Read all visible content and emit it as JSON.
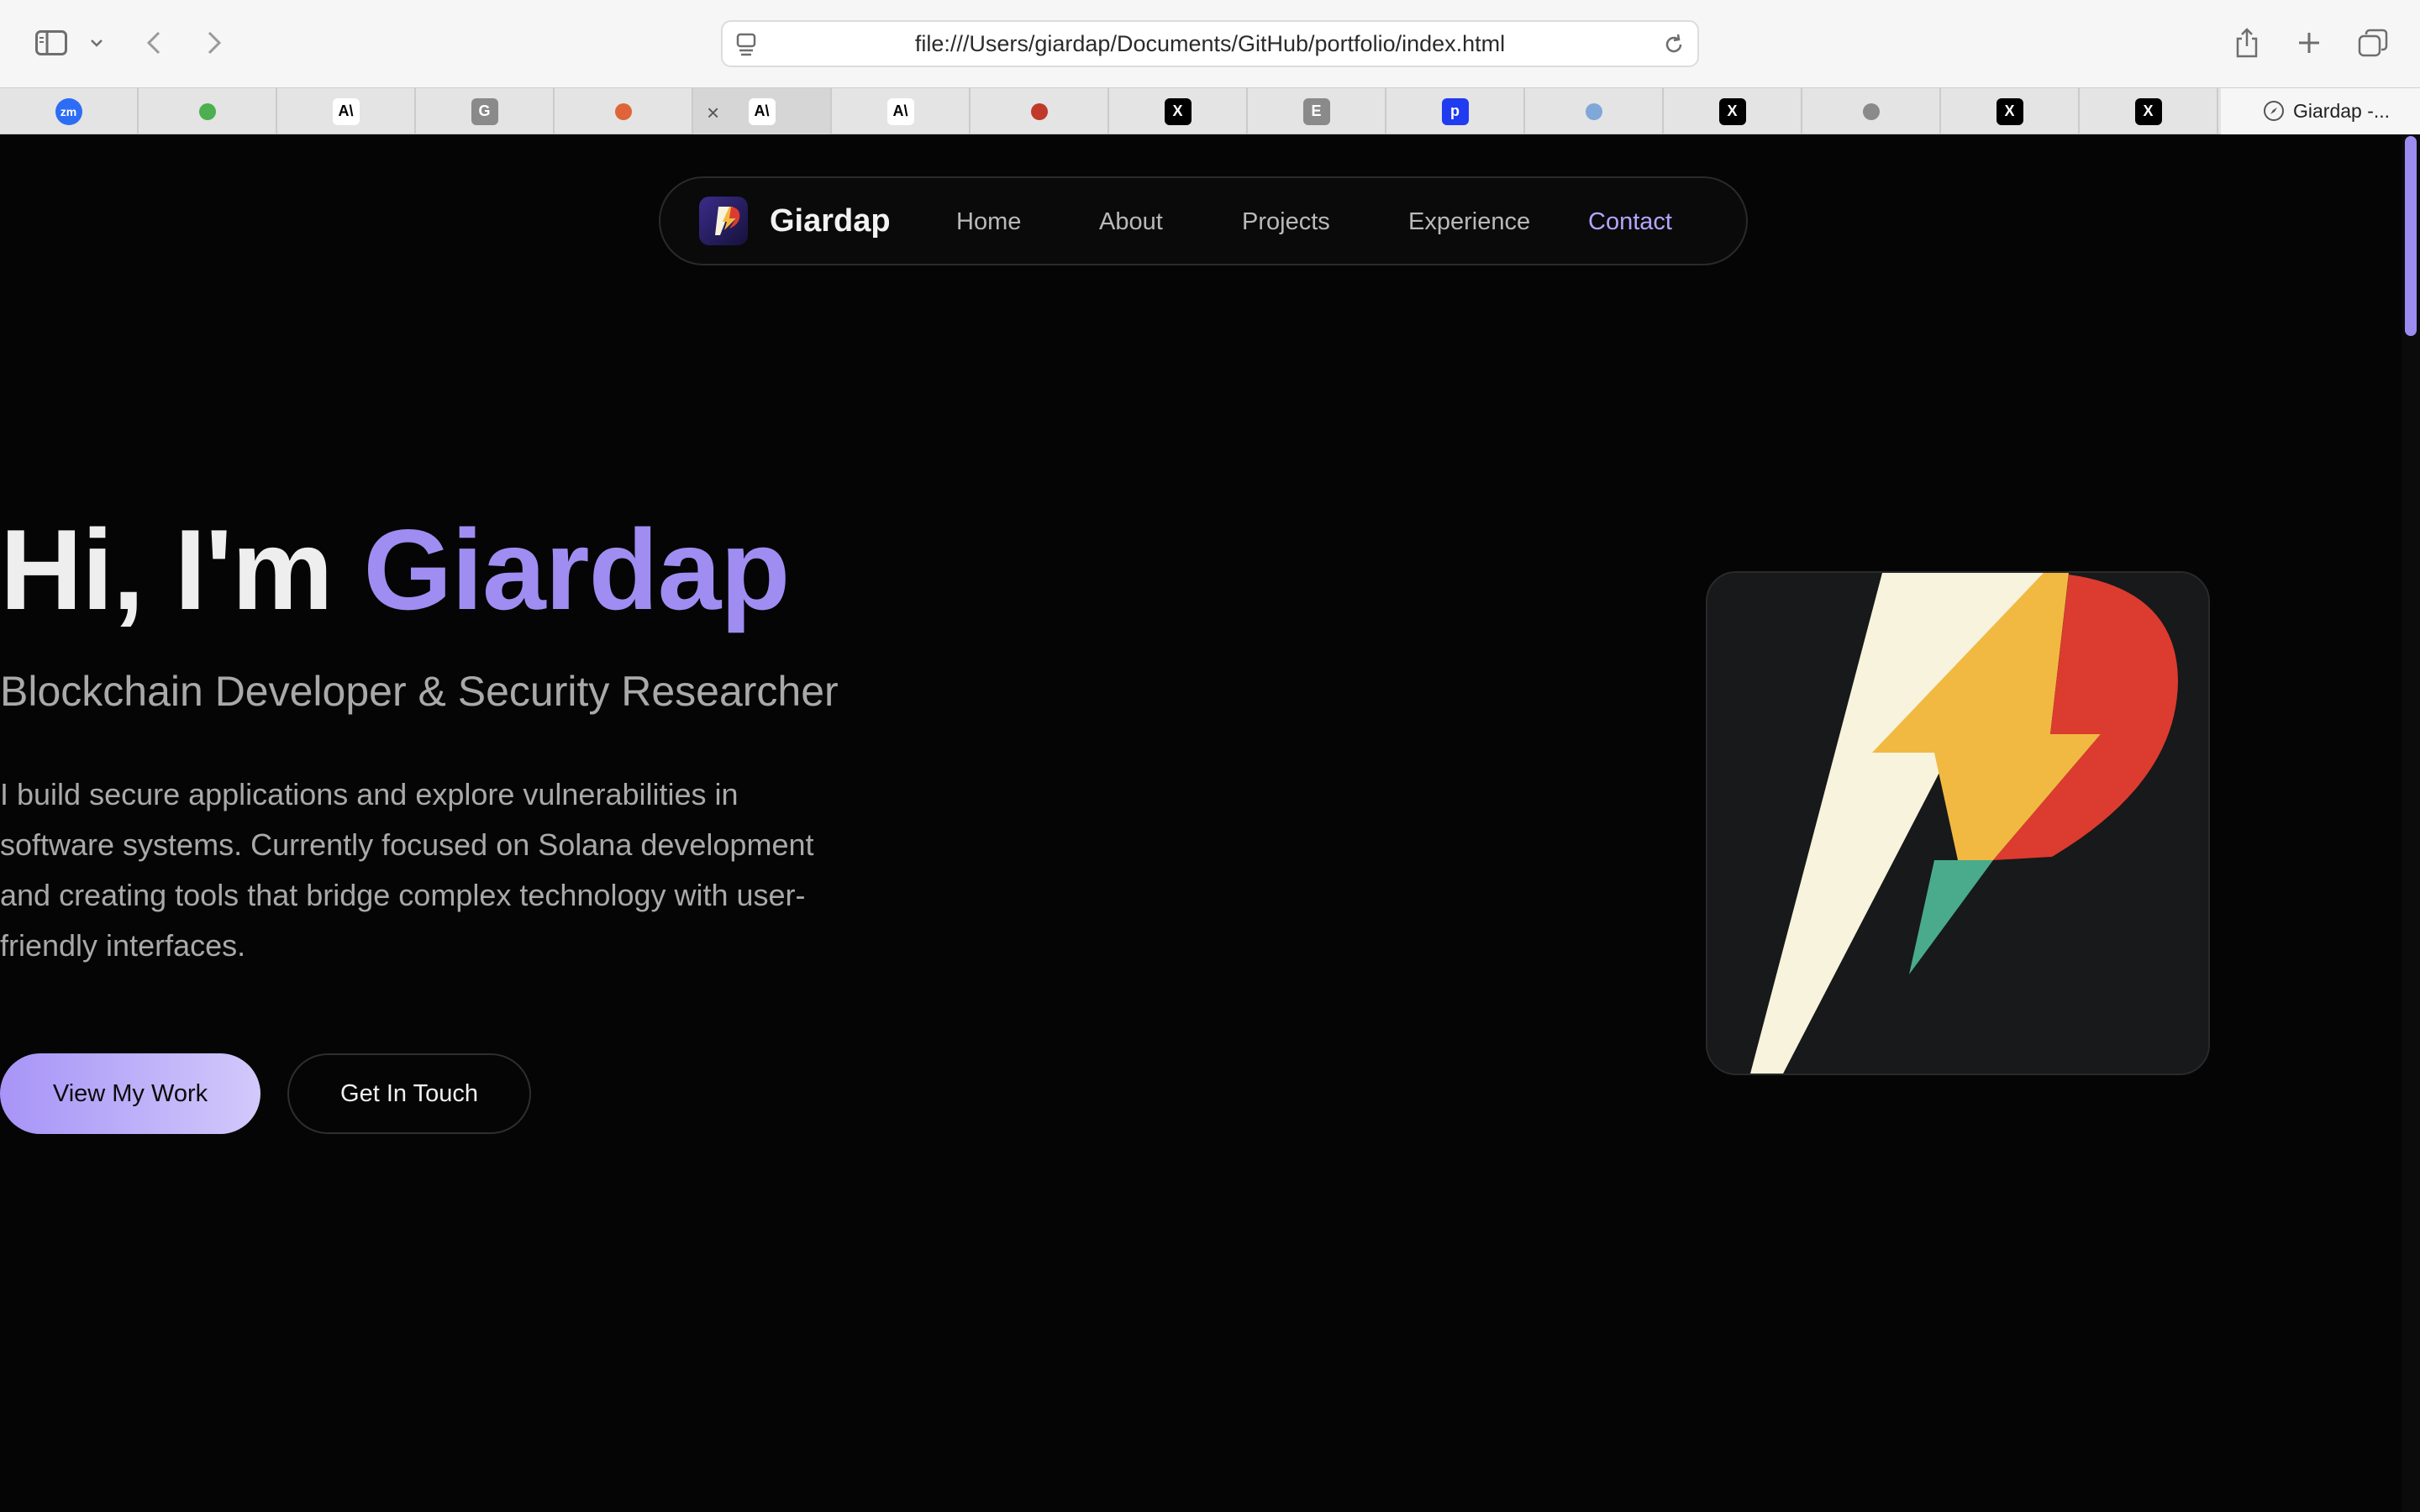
{
  "browser": {
    "url": "file:///Users/giardap/Documents/GitHub/portfolio/index.html",
    "tabs": [
      {
        "icon": "zoom-icon",
        "text": "zm",
        "color": "#2d6df6"
      },
      {
        "icon": "green-blob-icon",
        "text": "",
        "color": "#4caf50"
      },
      {
        "icon": "anthropic-icon",
        "text": "A\\",
        "color": "#ffffff"
      },
      {
        "icon": "g-icon",
        "text": "G",
        "color": "#8a8a8a"
      },
      {
        "icon": "claude-burst-icon",
        "text": "",
        "color": "#e0643a"
      },
      {
        "icon": "anthropic-icon",
        "text": "A\\",
        "color": "#ffffff"
      },
      {
        "icon": "anthropic-icon",
        "text": "A\\",
        "color": "#ffffff"
      },
      {
        "icon": "bank-flag-icon",
        "text": "",
        "color": "#c0392b"
      },
      {
        "icon": "x-icon",
        "text": "X",
        "color": "#000000"
      },
      {
        "icon": "e-icon",
        "text": "E",
        "color": "#8a8a8a"
      },
      {
        "icon": "p-icon",
        "text": "p",
        "color": "#1f3cf0"
      },
      {
        "icon": "document-icon",
        "text": "",
        "color": "#7fa7d8"
      },
      {
        "icon": "x-icon",
        "text": "X",
        "color": "#000000"
      },
      {
        "icon": "circle-logo-icon",
        "text": "",
        "color": "#8a8a8a"
      },
      {
        "icon": "x-icon",
        "text": "X",
        "color": "#000000"
      },
      {
        "icon": "x-icon",
        "text": "X",
        "color": "#000000"
      }
    ],
    "active_tab_title": "Giardap -..."
  },
  "nav": {
    "brand": "Giardap",
    "links": [
      "Home",
      "About",
      "Projects",
      "Experience",
      "Contact"
    ],
    "active": "Contact"
  },
  "hero": {
    "greeting": "Hi, I'm",
    "name": "Giardap",
    "subtitle": "Blockchain Developer & Security Researcher",
    "description": "I build secure applications and explore vulnerabilities in software systems. Currently focused on Solana development and creating tools that bridge complex technology with user-friendly interfaces.",
    "primary_button": "View My Work",
    "secondary_button": "Get In Touch"
  },
  "colors": {
    "accent": "#9f8df1",
    "background": "#050505",
    "logo_cream": "#f7f3dc",
    "logo_yellow": "#f1b941",
    "logo_red": "#dc3b30",
    "logo_green": "#4aaa8c"
  }
}
